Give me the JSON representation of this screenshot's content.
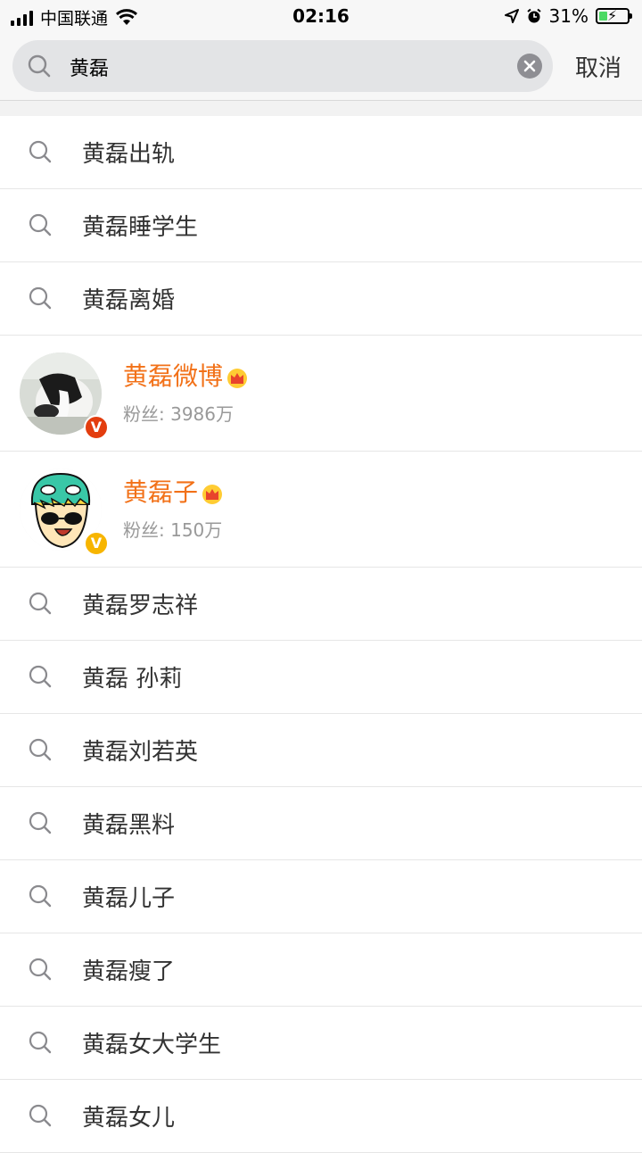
{
  "status_bar": {
    "carrier": "中国联通",
    "time": "02:16",
    "battery_percent": "31%",
    "battery_level": 0.31
  },
  "search": {
    "query": "黄磊",
    "cancel_label": "取消"
  },
  "suggestions_top": [
    {
      "text": "黄磊出轨"
    },
    {
      "text": "黄磊睡学生"
    },
    {
      "text": "黄磊离婚"
    }
  ],
  "users": [
    {
      "name": "黄磊微博",
      "fans": "粉丝: 3986万",
      "badge_color": "#e33d0e",
      "badge": "V"
    },
    {
      "name": "黄磊子",
      "fans": "粉丝: 150万",
      "badge_color": "#f7b500",
      "badge": "V"
    }
  ],
  "suggestions_bottom": [
    {
      "text": "黄磊罗志祥"
    },
    {
      "text": "黄磊 孙莉"
    },
    {
      "text": "黄磊刘若英"
    },
    {
      "text": "黄磊黑料"
    },
    {
      "text": "黄磊儿子"
    },
    {
      "text": "黄磊瘦了"
    },
    {
      "text": "黄磊女大学生"
    },
    {
      "text": "黄磊女儿"
    }
  ],
  "colors": {
    "accent_orange": "#f27118",
    "header_bg": "#f7f7f7"
  }
}
